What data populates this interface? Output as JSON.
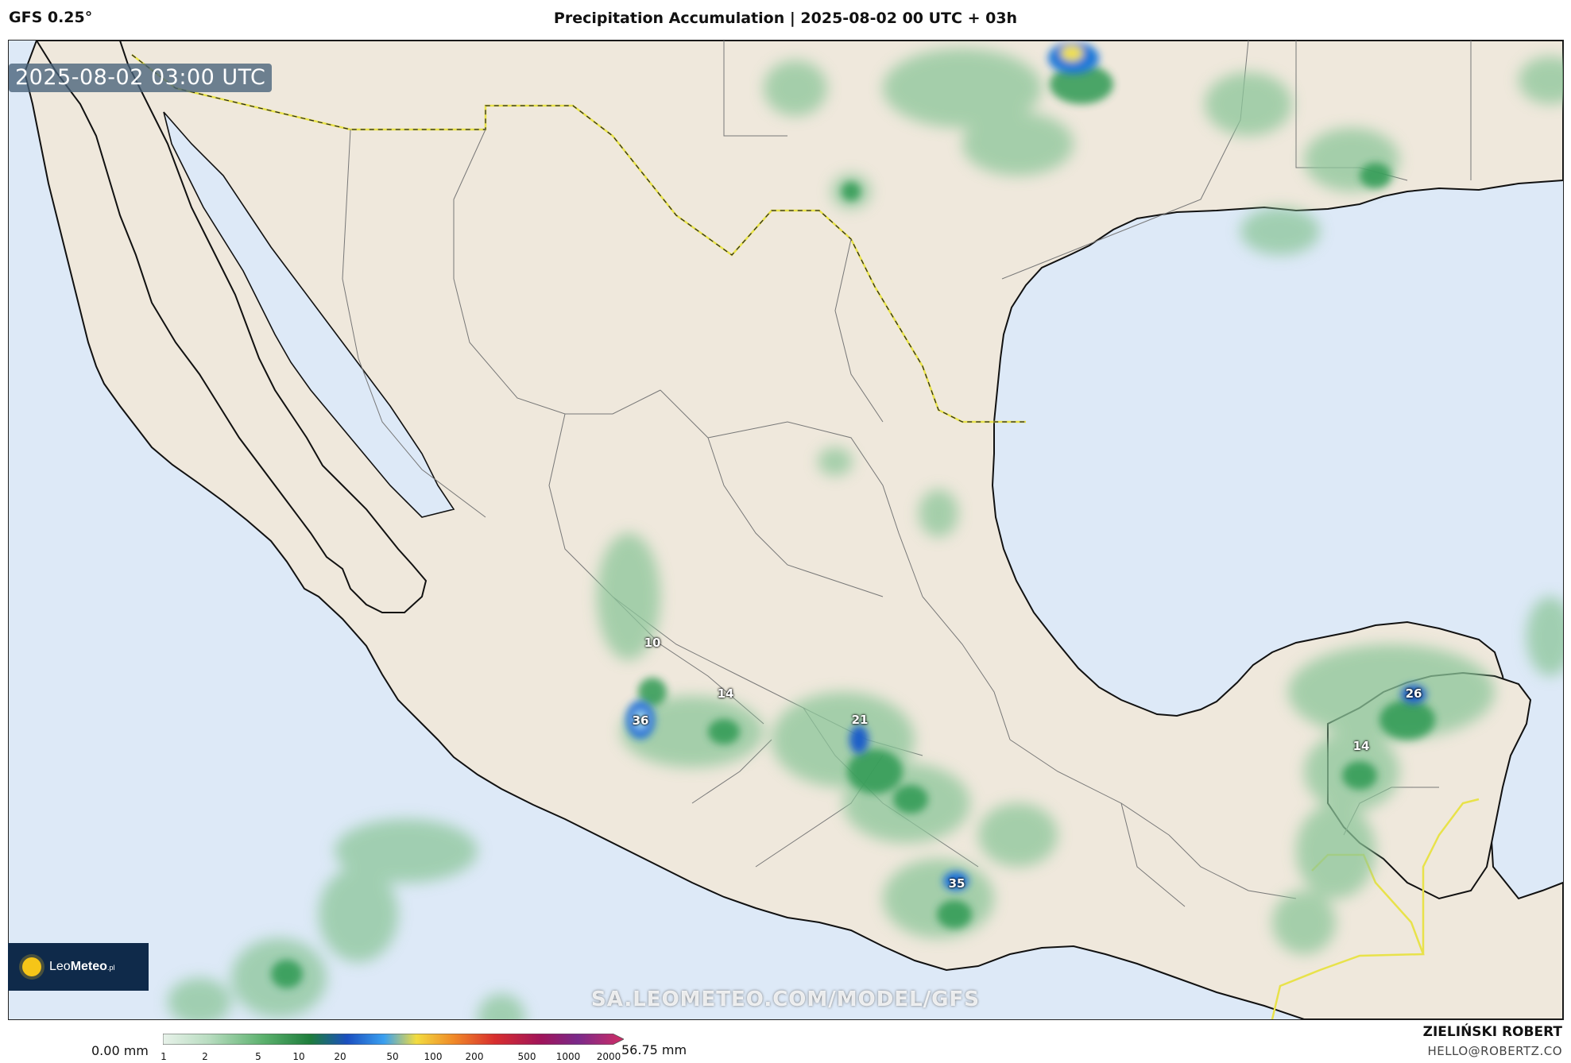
{
  "header": {
    "model": "GFS 0.25°",
    "title": "Precipitation Accumulation | 2025-08-02 00 UTC + 03h"
  },
  "map": {
    "valid_time": "2025-08-02 03:00 UTC",
    "watermark": "SA.LEOMETEO.COM/MODEL/GFS",
    "ocean_color": "#dde9f7",
    "land_color": "#efe8dc",
    "value_labels": [
      "10",
      "14",
      "36",
      "21",
      "35",
      "26",
      "14"
    ]
  },
  "logo": {
    "brand_light": "Leo",
    "brand_bold": "Meteo",
    "suffix": ".pl"
  },
  "colorbar": {
    "min_label": "0.00 mm",
    "max_label": "56.75 mm",
    "ticks": [
      "1",
      "2",
      "5",
      "10",
      "20",
      "50",
      "100",
      "200",
      "500",
      "1000",
      "2000"
    ]
  },
  "credits": {
    "author": "ZIELIŃSKI ROBERT",
    "email": "HELLO@ROBERTZ.CO"
  }
}
